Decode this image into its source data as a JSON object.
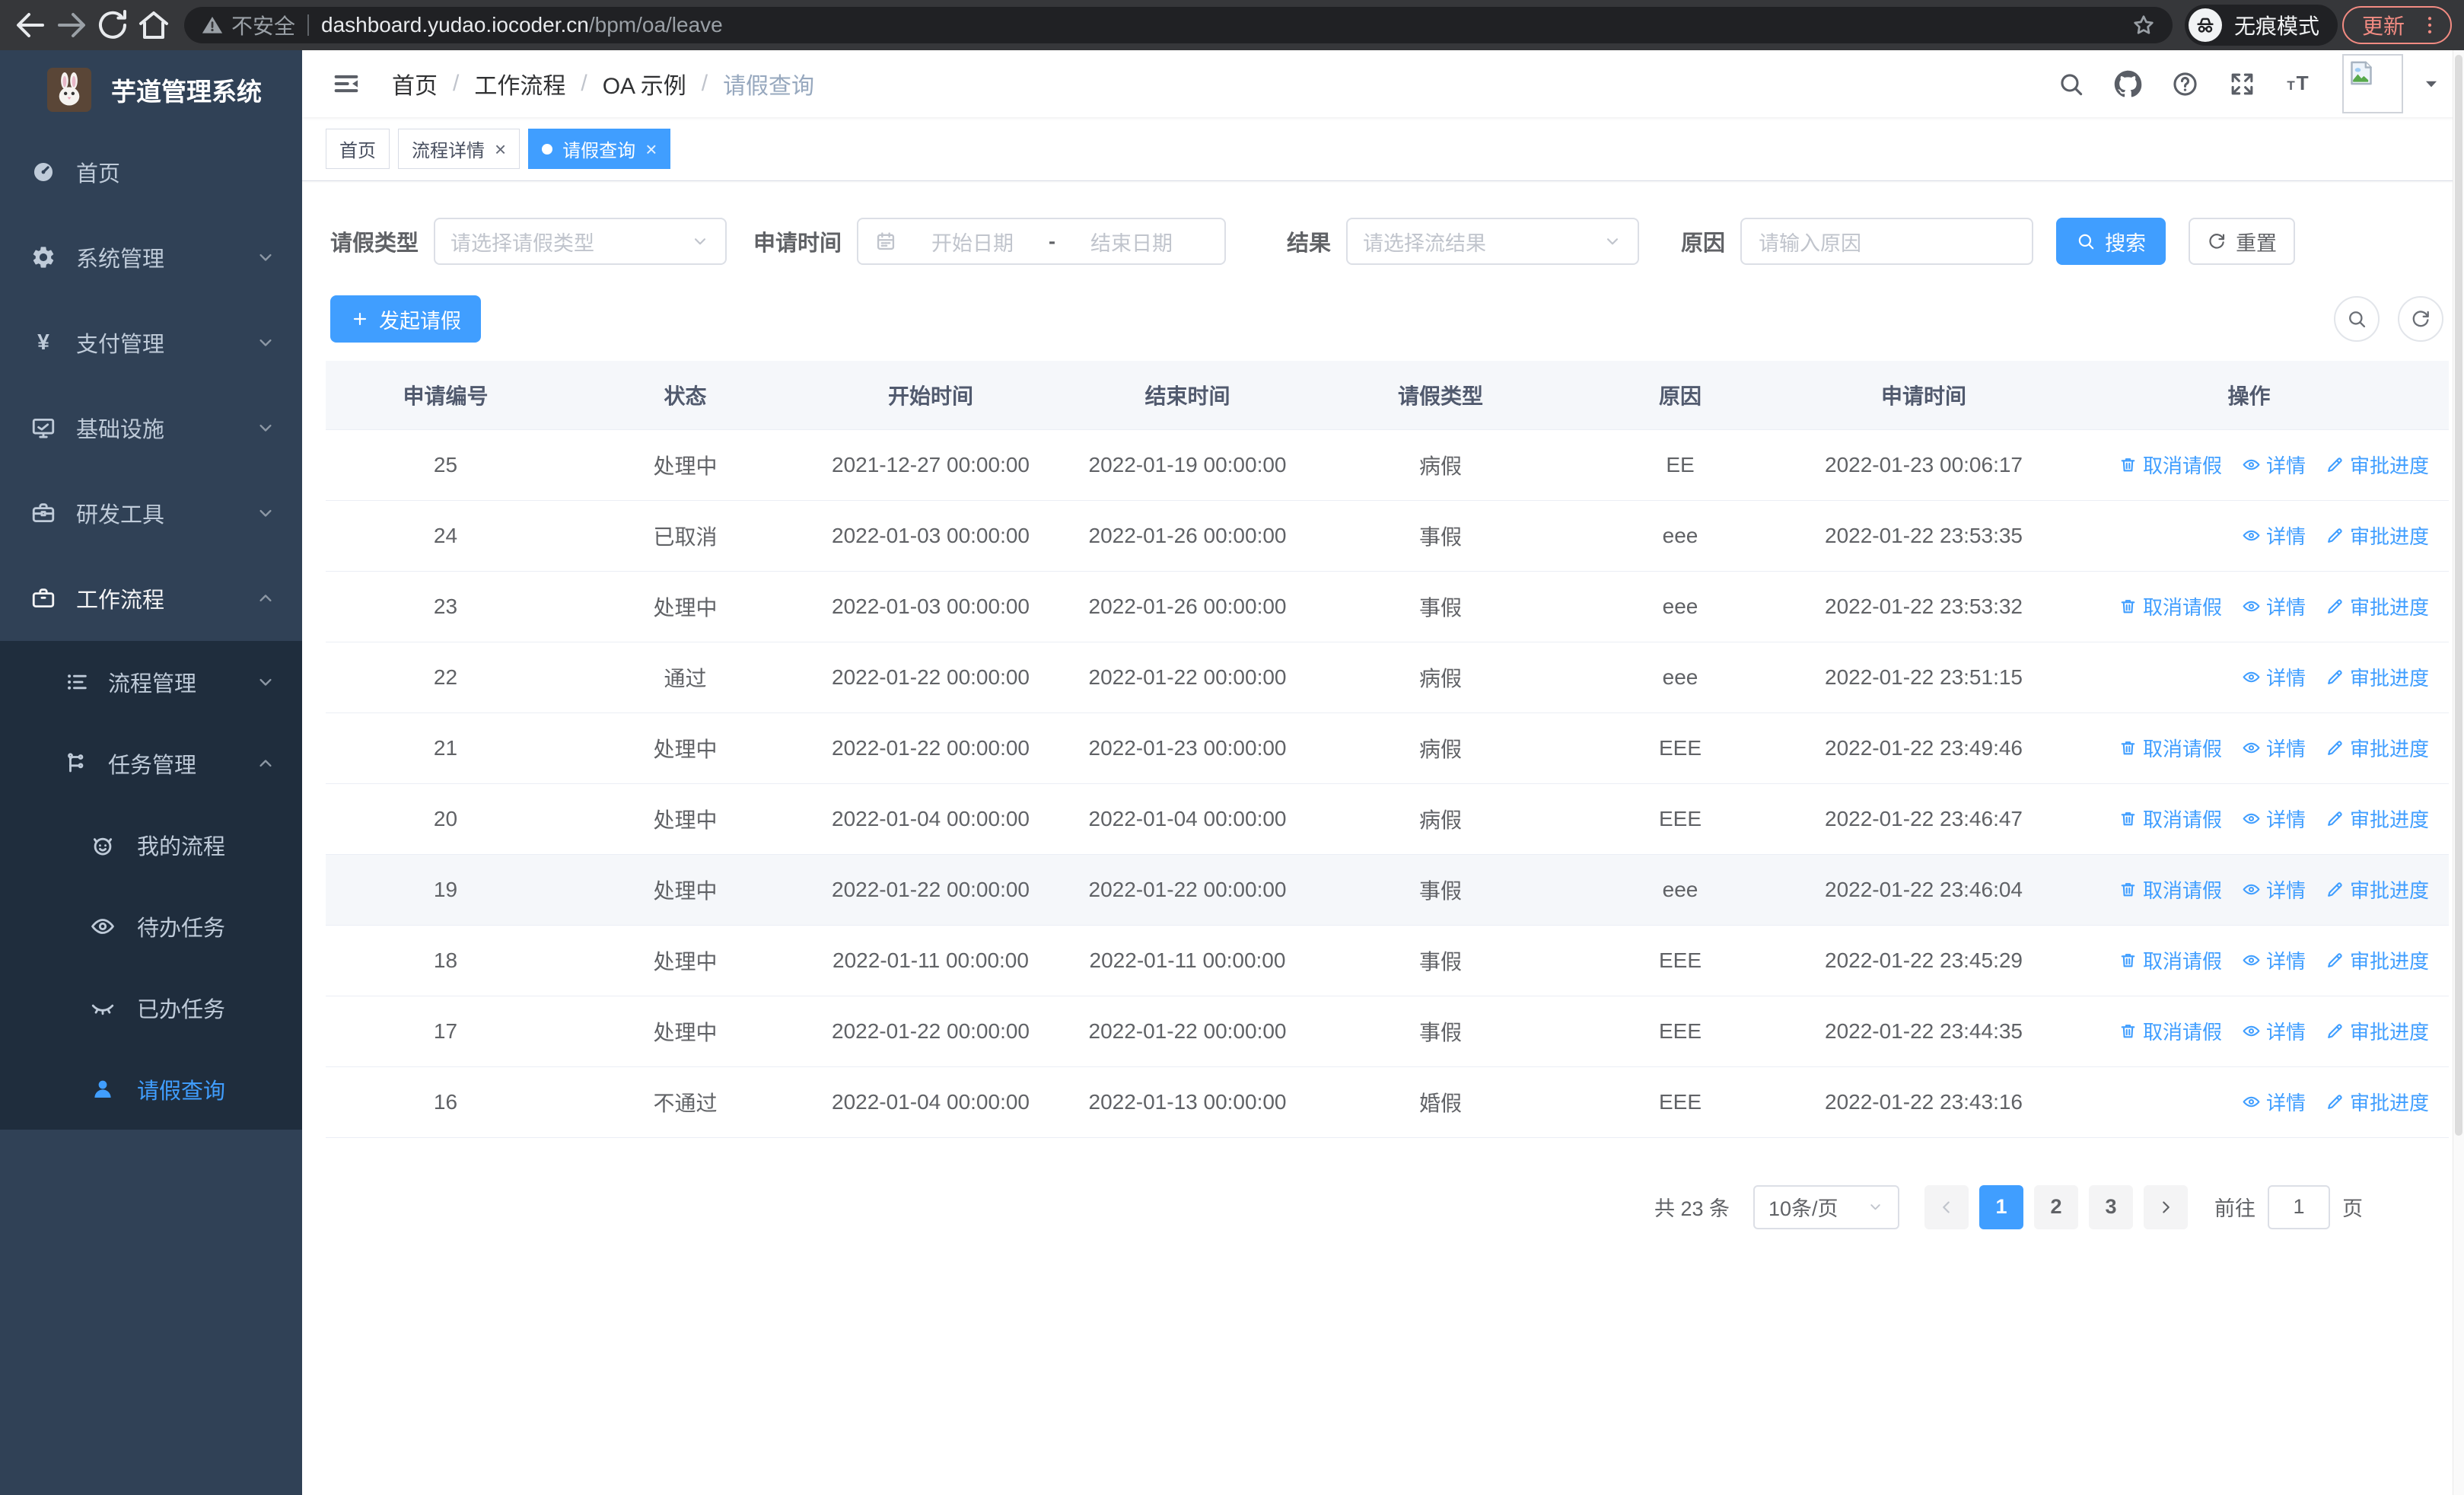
{
  "colors": {
    "accent": "#409eff",
    "sidebar_bg": "#304156",
    "submenu_bg": "#1f2d3d",
    "sidebar_text": "#bfcbd9",
    "browser_update_accent": "#f28b82"
  },
  "browser": {
    "security_label": "不安全",
    "url_host": "dashboard.yudao.iocoder.cn",
    "url_path": "/bpm/oa/leave",
    "incognito_label": "无痕模式",
    "update_label": "更新"
  },
  "sidebar": {
    "title": "芋道管理系统",
    "items": [
      {
        "key": "home",
        "label": "首页",
        "icon": "dashboard",
        "level": 1
      },
      {
        "key": "system",
        "label": "系统管理",
        "icon": "gear",
        "level": 1,
        "chevron": "down"
      },
      {
        "key": "payment",
        "label": "支付管理",
        "icon": "yen",
        "level": 1,
        "chevron": "down"
      },
      {
        "key": "infrastructure",
        "label": "基础设施",
        "icon": "monitor",
        "level": 1,
        "chevron": "down"
      },
      {
        "key": "dev-tools",
        "label": "研发工具",
        "icon": "toolbox",
        "level": 1,
        "chevron": "down"
      },
      {
        "key": "workflow",
        "label": "工作流程",
        "icon": "briefcase",
        "level": 1,
        "chevron": "up",
        "open": true
      },
      {
        "key": "process-mgmt",
        "label": "流程管理",
        "icon": "list",
        "level": 2,
        "chevron": "down"
      },
      {
        "key": "task-mgmt",
        "label": "任务管理",
        "icon": "tree",
        "level": 2,
        "chevron": "up"
      },
      {
        "key": "my-process",
        "label": "我的流程",
        "icon": "face",
        "level": 3
      },
      {
        "key": "todo-tasks",
        "label": "待办任务",
        "icon": "eye-open",
        "level": 3
      },
      {
        "key": "done-tasks",
        "label": "已办任务",
        "icon": "eye-closed",
        "level": 3
      },
      {
        "key": "leave-query",
        "label": "请假查询",
        "icon": "user",
        "level": 3,
        "active": true
      }
    ]
  },
  "breadcrumb": {
    "separator": "/",
    "items": [
      "首页",
      "工作流程",
      "OA 示例",
      "请假查询"
    ]
  },
  "tabs": {
    "close_glyph": "×",
    "items": [
      {
        "key": "home",
        "label": "首页",
        "active": false,
        "closable": false
      },
      {
        "key": "process-detail",
        "label": "流程详情",
        "active": false,
        "closable": true
      },
      {
        "key": "leave-query",
        "label": "请假查询",
        "active": true,
        "closable": true
      }
    ]
  },
  "filters": {
    "leave_type": {
      "label": "请假类型",
      "placeholder": "请选择请假类型"
    },
    "apply_time": {
      "label": "申请时间",
      "start_placeholder": "开始日期",
      "separator": "-",
      "end_placeholder": "结束日期"
    },
    "result": {
      "label": "结果",
      "placeholder": "请选择流结果"
    },
    "reason": {
      "label": "原因",
      "placeholder": "请输入原因"
    },
    "search_label": "搜索",
    "reset_label": "重置"
  },
  "toolbar": {
    "create_label": "发起请假"
  },
  "table": {
    "columns": [
      "申请编号",
      "状态",
      "开始时间",
      "结束时间",
      "请假类型",
      "原因",
      "申请时间",
      "操作"
    ],
    "action_labels": {
      "cancel": "取消请假",
      "detail": "详情",
      "progress": "审批进度"
    },
    "rows": [
      {
        "id": "25",
        "status": "处理中",
        "start": "2021-12-27 00:00:00",
        "end": "2022-01-19 00:00:00",
        "type": "病假",
        "reason": "EE",
        "applied": "2022-01-23 00:06:17",
        "cancellable": true,
        "hover": false
      },
      {
        "id": "24",
        "status": "已取消",
        "start": "2022-01-03 00:00:00",
        "end": "2022-01-26 00:00:00",
        "type": "事假",
        "reason": "eee",
        "applied": "2022-01-22 23:53:35",
        "cancellable": false,
        "hover": false
      },
      {
        "id": "23",
        "status": "处理中",
        "start": "2022-01-03 00:00:00",
        "end": "2022-01-26 00:00:00",
        "type": "事假",
        "reason": "eee",
        "applied": "2022-01-22 23:53:32",
        "cancellable": true,
        "hover": false
      },
      {
        "id": "22",
        "status": "通过",
        "start": "2022-01-22 00:00:00",
        "end": "2022-01-22 00:00:00",
        "type": "病假",
        "reason": "eee",
        "applied": "2022-01-22 23:51:15",
        "cancellable": false,
        "hover": false
      },
      {
        "id": "21",
        "status": "处理中",
        "start": "2022-01-22 00:00:00",
        "end": "2022-01-23 00:00:00",
        "type": "病假",
        "reason": "EEE",
        "applied": "2022-01-22 23:49:46",
        "cancellable": true,
        "hover": false
      },
      {
        "id": "20",
        "status": "处理中",
        "start": "2022-01-04 00:00:00",
        "end": "2022-01-04 00:00:00",
        "type": "病假",
        "reason": "EEE",
        "applied": "2022-01-22 23:46:47",
        "cancellable": true,
        "hover": false
      },
      {
        "id": "19",
        "status": "处理中",
        "start": "2022-01-22 00:00:00",
        "end": "2022-01-22 00:00:00",
        "type": "事假",
        "reason": "eee",
        "applied": "2022-01-22 23:46:04",
        "cancellable": true,
        "hover": true
      },
      {
        "id": "18",
        "status": "处理中",
        "start": "2022-01-11 00:00:00",
        "end": "2022-01-11 00:00:00",
        "type": "事假",
        "reason": "EEE",
        "applied": "2022-01-22 23:45:29",
        "cancellable": true,
        "hover": false
      },
      {
        "id": "17",
        "status": "处理中",
        "start": "2022-01-22 00:00:00",
        "end": "2022-01-22 00:00:00",
        "type": "事假",
        "reason": "EEE",
        "applied": "2022-01-22 23:44:35",
        "cancellable": true,
        "hover": false
      },
      {
        "id": "16",
        "status": "不通过",
        "start": "2022-01-04 00:00:00",
        "end": "2022-01-13 00:00:00",
        "type": "婚假",
        "reason": "EEE",
        "applied": "2022-01-22 23:43:16",
        "cancellable": false,
        "hover": false
      }
    ]
  },
  "pagination": {
    "total": "共 23 条",
    "page_size": "10条/页",
    "pages": [
      "1",
      "2",
      "3"
    ],
    "active_page": "1",
    "prev_disabled": true,
    "goto_label": "前往",
    "goto_value": "1",
    "unit_label": "页"
  }
}
